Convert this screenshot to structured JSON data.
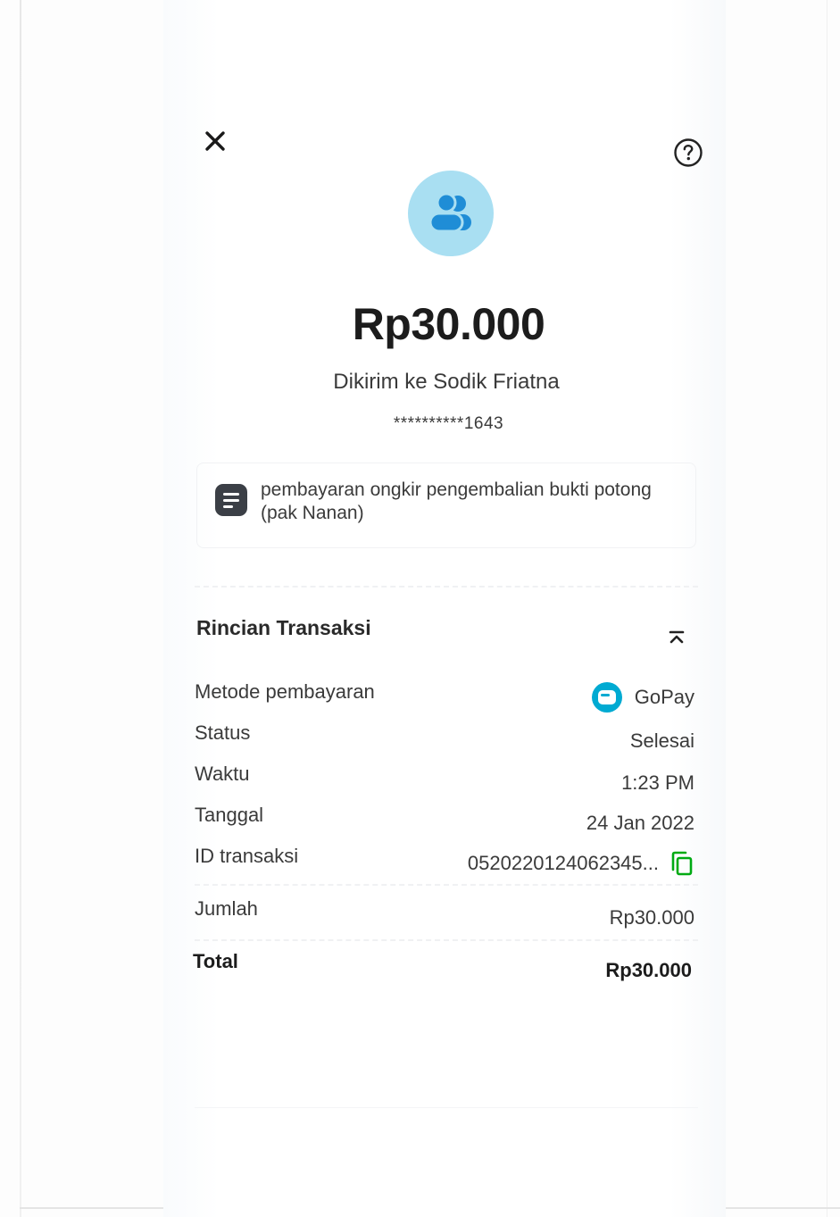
{
  "header": {
    "close_icon": "close-icon",
    "help_icon": "help-circle-icon"
  },
  "recipient_avatar": {
    "icon": "people-icon",
    "color": "#a9dff2",
    "icon_color": "#1f8dd6"
  },
  "amount": "Rp30.000",
  "recipient_line": "Dikirim ke Sodik Friatna",
  "account_masked": "**********1643",
  "note": {
    "icon": "note-icon",
    "text_line1": "pembayaran ongkir pengembalian bukti potong",
    "text_line2": "(pak Nanan)"
  },
  "details": {
    "title": "Rincian Transaksi",
    "collapse_icon": "chevron-up-double-icon",
    "payment_method_label": "Metode pembayaran",
    "payment_method_value": "GoPay",
    "payment_method_icon": "gopay-wallet-icon",
    "status_label": "Status",
    "status_value": "Selesai",
    "time_label": "Waktu",
    "time_value": "1:23 PM",
    "date_label": "Tanggal",
    "date_value": "24 Jan 2022",
    "txid_label": "ID transaksi",
    "txid_value": "0520220124062345...",
    "copy_icon": "copy-icon",
    "amount_label": "Jumlah",
    "amount_value": "Rp30.000",
    "total_label": "Total",
    "total_value": "Rp30.000"
  },
  "colors": {
    "accent": "#00aad2",
    "text_dark": "#1c1c1c",
    "text_body": "#3a3a3a",
    "copy_green": "#00aa13"
  }
}
